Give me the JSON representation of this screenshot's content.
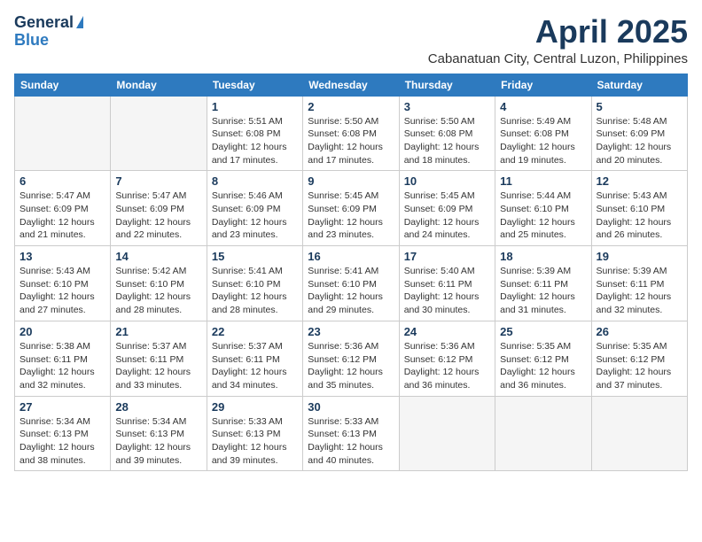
{
  "logo": {
    "general": "General",
    "blue": "Blue"
  },
  "header": {
    "month": "April 2025",
    "location": "Cabanatuan City, Central Luzon, Philippines"
  },
  "weekdays": [
    "Sunday",
    "Monday",
    "Tuesday",
    "Wednesday",
    "Thursday",
    "Friday",
    "Saturday"
  ],
  "weeks": [
    [
      {
        "day": "",
        "empty": true
      },
      {
        "day": "",
        "empty": true
      },
      {
        "day": "1",
        "sunrise": "Sunrise: 5:51 AM",
        "sunset": "Sunset: 6:08 PM",
        "daylight": "Daylight: 12 hours and 17 minutes."
      },
      {
        "day": "2",
        "sunrise": "Sunrise: 5:50 AM",
        "sunset": "Sunset: 6:08 PM",
        "daylight": "Daylight: 12 hours and 17 minutes."
      },
      {
        "day": "3",
        "sunrise": "Sunrise: 5:50 AM",
        "sunset": "Sunset: 6:08 PM",
        "daylight": "Daylight: 12 hours and 18 minutes."
      },
      {
        "day": "4",
        "sunrise": "Sunrise: 5:49 AM",
        "sunset": "Sunset: 6:08 PM",
        "daylight": "Daylight: 12 hours and 19 minutes."
      },
      {
        "day": "5",
        "sunrise": "Sunrise: 5:48 AM",
        "sunset": "Sunset: 6:09 PM",
        "daylight": "Daylight: 12 hours and 20 minutes."
      }
    ],
    [
      {
        "day": "6",
        "sunrise": "Sunrise: 5:47 AM",
        "sunset": "Sunset: 6:09 PM",
        "daylight": "Daylight: 12 hours and 21 minutes."
      },
      {
        "day": "7",
        "sunrise": "Sunrise: 5:47 AM",
        "sunset": "Sunset: 6:09 PM",
        "daylight": "Daylight: 12 hours and 22 minutes."
      },
      {
        "day": "8",
        "sunrise": "Sunrise: 5:46 AM",
        "sunset": "Sunset: 6:09 PM",
        "daylight": "Daylight: 12 hours and 23 minutes."
      },
      {
        "day": "9",
        "sunrise": "Sunrise: 5:45 AM",
        "sunset": "Sunset: 6:09 PM",
        "daylight": "Daylight: 12 hours and 23 minutes."
      },
      {
        "day": "10",
        "sunrise": "Sunrise: 5:45 AM",
        "sunset": "Sunset: 6:09 PM",
        "daylight": "Daylight: 12 hours and 24 minutes."
      },
      {
        "day": "11",
        "sunrise": "Sunrise: 5:44 AM",
        "sunset": "Sunset: 6:10 PM",
        "daylight": "Daylight: 12 hours and 25 minutes."
      },
      {
        "day": "12",
        "sunrise": "Sunrise: 5:43 AM",
        "sunset": "Sunset: 6:10 PM",
        "daylight": "Daylight: 12 hours and 26 minutes."
      }
    ],
    [
      {
        "day": "13",
        "sunrise": "Sunrise: 5:43 AM",
        "sunset": "Sunset: 6:10 PM",
        "daylight": "Daylight: 12 hours and 27 minutes."
      },
      {
        "day": "14",
        "sunrise": "Sunrise: 5:42 AM",
        "sunset": "Sunset: 6:10 PM",
        "daylight": "Daylight: 12 hours and 28 minutes."
      },
      {
        "day": "15",
        "sunrise": "Sunrise: 5:41 AM",
        "sunset": "Sunset: 6:10 PM",
        "daylight": "Daylight: 12 hours and 28 minutes."
      },
      {
        "day": "16",
        "sunrise": "Sunrise: 5:41 AM",
        "sunset": "Sunset: 6:10 PM",
        "daylight": "Daylight: 12 hours and 29 minutes."
      },
      {
        "day": "17",
        "sunrise": "Sunrise: 5:40 AM",
        "sunset": "Sunset: 6:11 PM",
        "daylight": "Daylight: 12 hours and 30 minutes."
      },
      {
        "day": "18",
        "sunrise": "Sunrise: 5:39 AM",
        "sunset": "Sunset: 6:11 PM",
        "daylight": "Daylight: 12 hours and 31 minutes."
      },
      {
        "day": "19",
        "sunrise": "Sunrise: 5:39 AM",
        "sunset": "Sunset: 6:11 PM",
        "daylight": "Daylight: 12 hours and 32 minutes."
      }
    ],
    [
      {
        "day": "20",
        "sunrise": "Sunrise: 5:38 AM",
        "sunset": "Sunset: 6:11 PM",
        "daylight": "Daylight: 12 hours and 32 minutes."
      },
      {
        "day": "21",
        "sunrise": "Sunrise: 5:37 AM",
        "sunset": "Sunset: 6:11 PM",
        "daylight": "Daylight: 12 hours and 33 minutes."
      },
      {
        "day": "22",
        "sunrise": "Sunrise: 5:37 AM",
        "sunset": "Sunset: 6:11 PM",
        "daylight": "Daylight: 12 hours and 34 minutes."
      },
      {
        "day": "23",
        "sunrise": "Sunrise: 5:36 AM",
        "sunset": "Sunset: 6:12 PM",
        "daylight": "Daylight: 12 hours and 35 minutes."
      },
      {
        "day": "24",
        "sunrise": "Sunrise: 5:36 AM",
        "sunset": "Sunset: 6:12 PM",
        "daylight": "Daylight: 12 hours and 36 minutes."
      },
      {
        "day": "25",
        "sunrise": "Sunrise: 5:35 AM",
        "sunset": "Sunset: 6:12 PM",
        "daylight": "Daylight: 12 hours and 36 minutes."
      },
      {
        "day": "26",
        "sunrise": "Sunrise: 5:35 AM",
        "sunset": "Sunset: 6:12 PM",
        "daylight": "Daylight: 12 hours and 37 minutes."
      }
    ],
    [
      {
        "day": "27",
        "sunrise": "Sunrise: 5:34 AM",
        "sunset": "Sunset: 6:13 PM",
        "daylight": "Daylight: 12 hours and 38 minutes."
      },
      {
        "day": "28",
        "sunrise": "Sunrise: 5:34 AM",
        "sunset": "Sunset: 6:13 PM",
        "daylight": "Daylight: 12 hours and 39 minutes."
      },
      {
        "day": "29",
        "sunrise": "Sunrise: 5:33 AM",
        "sunset": "Sunset: 6:13 PM",
        "daylight": "Daylight: 12 hours and 39 minutes."
      },
      {
        "day": "30",
        "sunrise": "Sunrise: 5:33 AM",
        "sunset": "Sunset: 6:13 PM",
        "daylight": "Daylight: 12 hours and 40 minutes."
      },
      {
        "day": "",
        "empty": true
      },
      {
        "day": "",
        "empty": true
      },
      {
        "day": "",
        "empty": true
      }
    ]
  ]
}
